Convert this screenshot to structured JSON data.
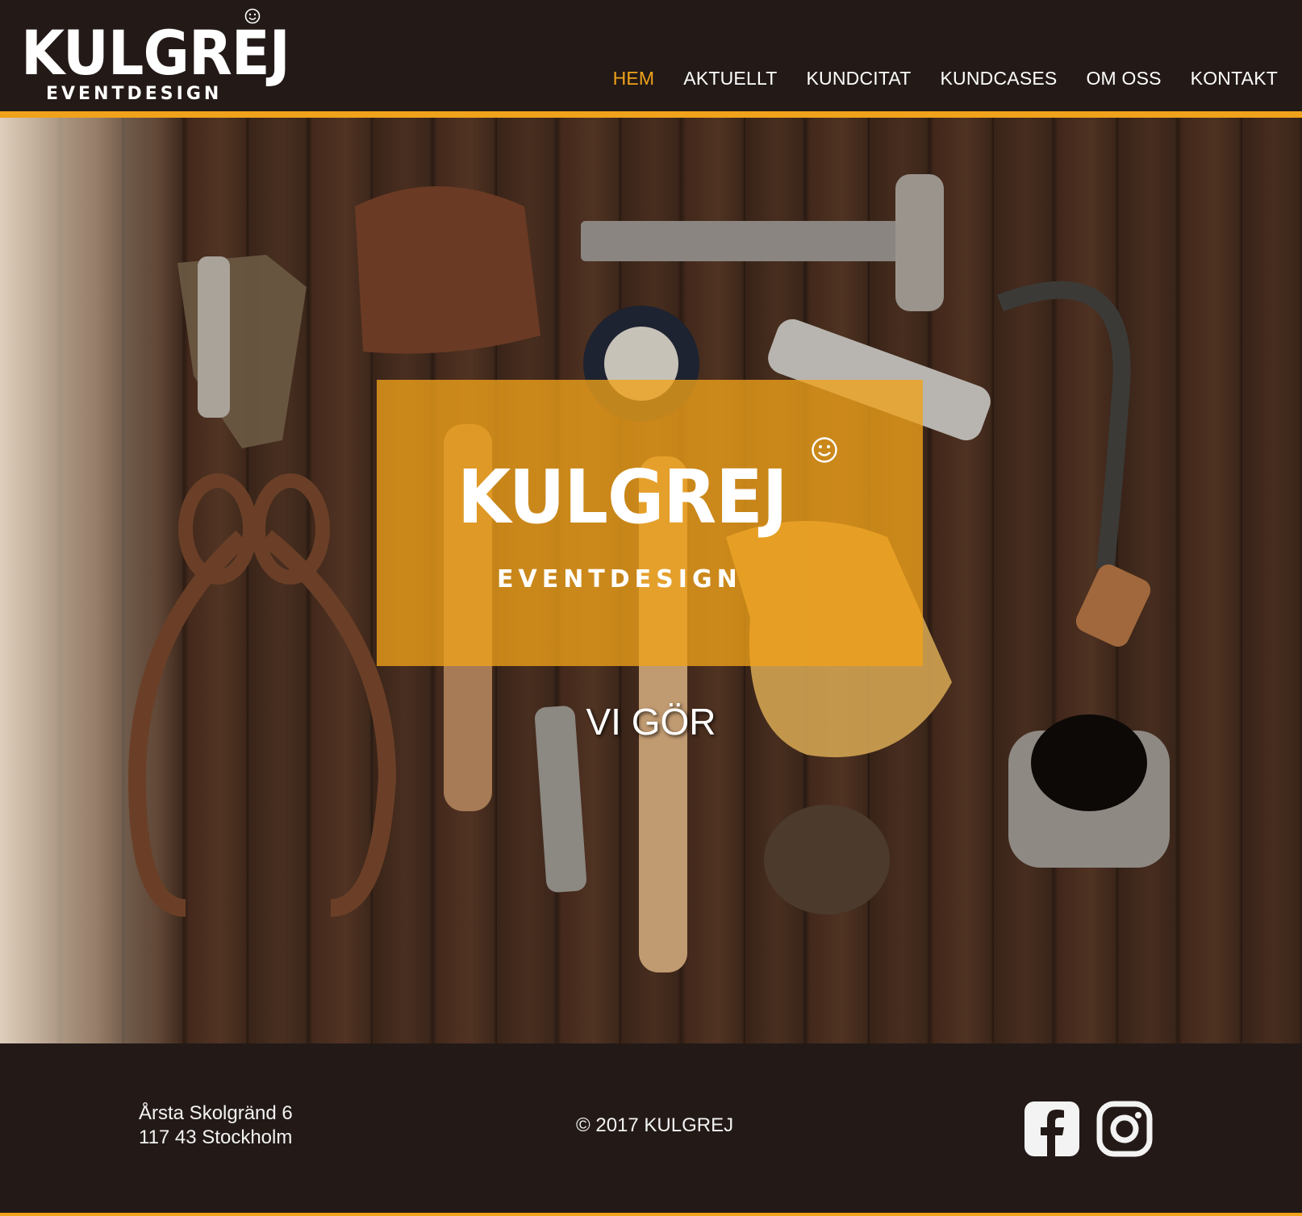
{
  "header": {
    "logo_main": "KULGREJ",
    "logo_sub": "EVENTDESIGN",
    "nav": [
      {
        "label": "HEM",
        "active": true
      },
      {
        "label": "AKTUELLT",
        "active": false
      },
      {
        "label": "KUNDCITAT",
        "active": false
      },
      {
        "label": "KUNDCASES",
        "active": false
      },
      {
        "label": "OM OSS",
        "active": false
      },
      {
        "label": "KONTAKT",
        "active": false
      }
    ]
  },
  "hero": {
    "logo_main": "KULGREJ",
    "logo_sub": "EVENTDESIGN",
    "tagline": "VI GÖR"
  },
  "footer": {
    "address_line1": "Årsta Skolgränd 6",
    "address_line2": "117 43 Stockholm",
    "copyright": "© 2017 KULGREJ",
    "social": [
      "facebook-icon",
      "instagram-icon"
    ]
  },
  "colors": {
    "accent": "#f0a21a",
    "background": "#231a17",
    "text": "#ffffff"
  }
}
